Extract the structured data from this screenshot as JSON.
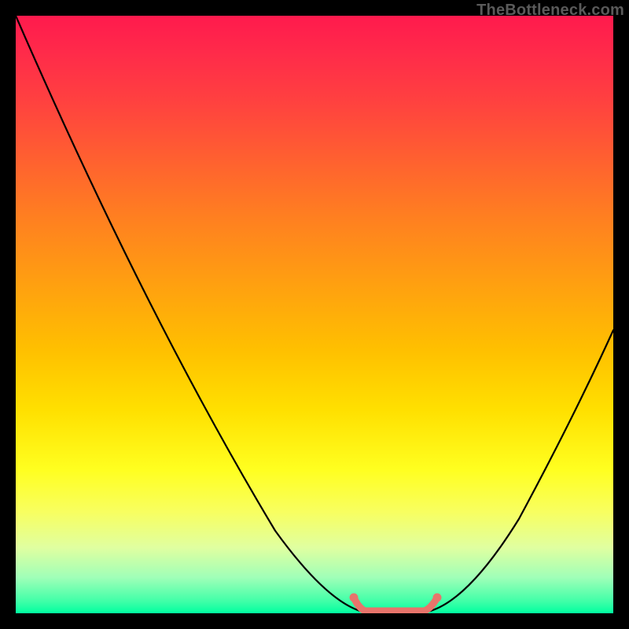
{
  "watermark": "TheBottleneck.com",
  "chart_data": {
    "type": "line",
    "title": "",
    "xlabel": "",
    "ylabel": "",
    "xlim": [
      0,
      100
    ],
    "ylim": [
      0,
      100
    ],
    "series": [
      {
        "name": "bottleneck-curve",
        "x": [
          0,
          58,
          69,
          100
        ],
        "y": [
          100,
          0,
          0,
          47
        ],
        "color": "#000000"
      },
      {
        "name": "optimal-zone",
        "x": [
          56.5,
          58,
          63.5,
          69,
          70.5
        ],
        "y": [
          2.4,
          0.3,
          0,
          0.3,
          2.4
        ],
        "color": "#e8746b"
      }
    ],
    "gradient_stops": [
      {
        "pos": 0.0,
        "color": "#ff1a4d"
      },
      {
        "pos": 0.5,
        "color": "#ffc000"
      },
      {
        "pos": 0.8,
        "color": "#ffff40"
      },
      {
        "pos": 1.0,
        "color": "#00ffa0"
      }
    ]
  }
}
